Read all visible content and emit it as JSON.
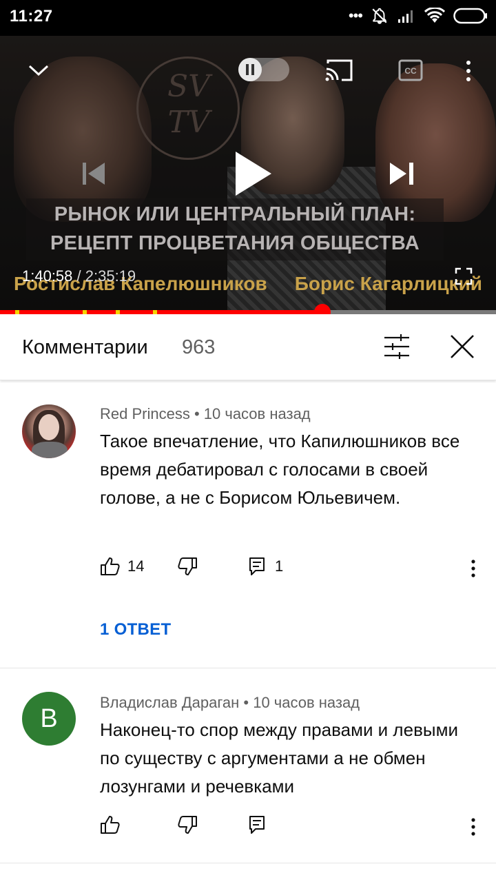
{
  "status_bar": {
    "time": "11:27",
    "icons": [
      "dots-icon",
      "notifications-off-icon",
      "signal-icon",
      "wifi-icon",
      "battery-icon"
    ]
  },
  "video": {
    "title_line1": "РЫНОК ИЛИ ЦЕНТРАЛЬНЫЙ ПЛАН:",
    "title_line2": "РЕЦЕПТ ПРОЦВЕТАНИЯ ОБЩЕСТВА",
    "logo_text": "SV TV",
    "speaker_left": "Ростислав Капелюшников",
    "speaker_right": "Борис Кагарлицкий",
    "current_time": "1:40:58",
    "separator": " / ",
    "duration": "2:35:19",
    "progress_fraction": 0.65,
    "autoplay_on": false,
    "colors": {
      "progress": "#ff0000",
      "ad_marker": "#f6d400",
      "speaker_label": "#c9a24a"
    }
  },
  "comments_header": {
    "title": "Комментарии",
    "count": "963"
  },
  "comments": [
    {
      "author": "Red Princess",
      "time": "10 часов назад",
      "text": "Такое впечатление, что Капилюшников все время дебатировал с голосами в своей голове, а не с Борисом Юльевичем.",
      "likes": "14",
      "reply_count": "1",
      "replies_link": "1 ОТВЕТ"
    },
    {
      "author": "Владислав Дараган",
      "avatar_letter": "В",
      "avatar_color": "#2e7d32",
      "time": "10 часов назад",
      "text": "Наконец-то спор между правами и левыми по существу с аргументами а не обмен лозунгами и речевками",
      "likes": "",
      "reply_count": ""
    }
  ],
  "accent": {
    "link_blue": "#065fd4"
  }
}
